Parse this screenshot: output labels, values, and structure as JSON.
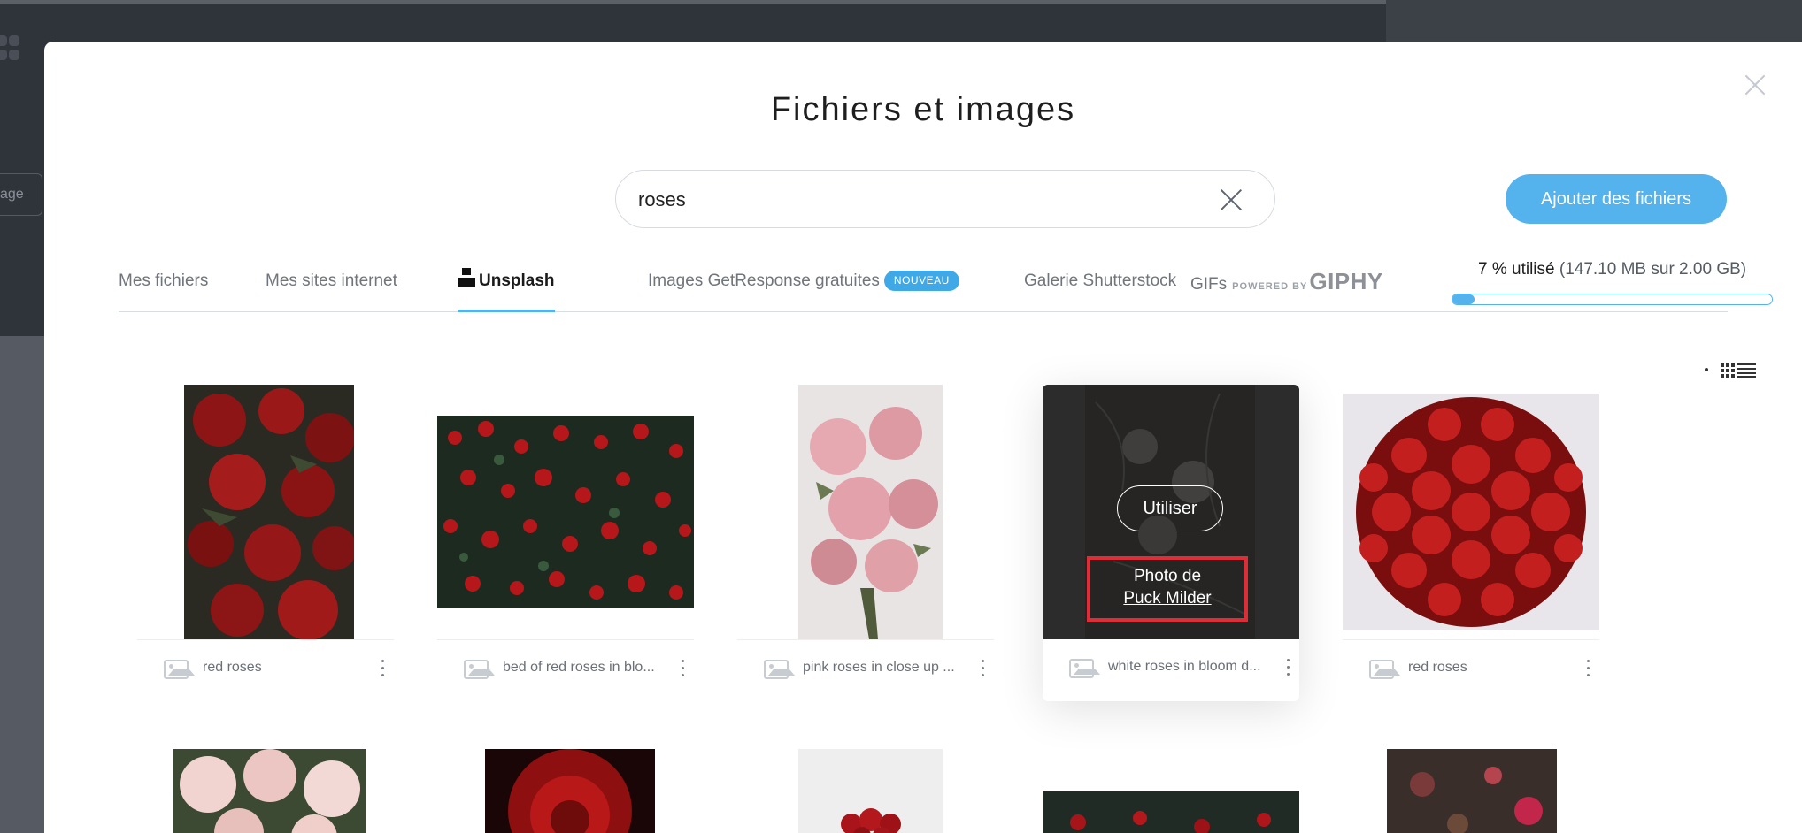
{
  "modal": {
    "title": "Fichiers et images",
    "search": {
      "value": "roses",
      "placeholder": ""
    },
    "add_button": "Ajouter des fichiers",
    "tabs": [
      {
        "label": "Mes fichiers"
      },
      {
        "label": "Mes sites internet"
      },
      {
        "label": "Unsplash",
        "active": true
      },
      {
        "label": "Images GetResponse gratuites",
        "badge": "NOUVEAU"
      },
      {
        "label": "Galerie Shutterstock"
      },
      {
        "label": "GIFs",
        "powered": "POWERED BY",
        "brand": "GIPHY"
      }
    ],
    "usage": {
      "percent_text": "7 % utilisé",
      "detail": "(147.10 MB sur 2.00 GB)",
      "fraction": 0.07
    },
    "results": [
      {
        "name": "red roses"
      },
      {
        "name": "bed of red roses in blo..."
      },
      {
        "name": "pink roses in close up ..."
      },
      {
        "name": "white roses in bloom d...",
        "overlay": {
          "use_label": "Utiliser",
          "credit_prefix": "Photo de",
          "credit_author": "Puck Milder"
        }
      },
      {
        "name": "red roses"
      }
    ],
    "accent_color": "#54b3ec",
    "highlight_color": "#e02c36"
  },
  "background": {
    "button_fragment": "age"
  }
}
